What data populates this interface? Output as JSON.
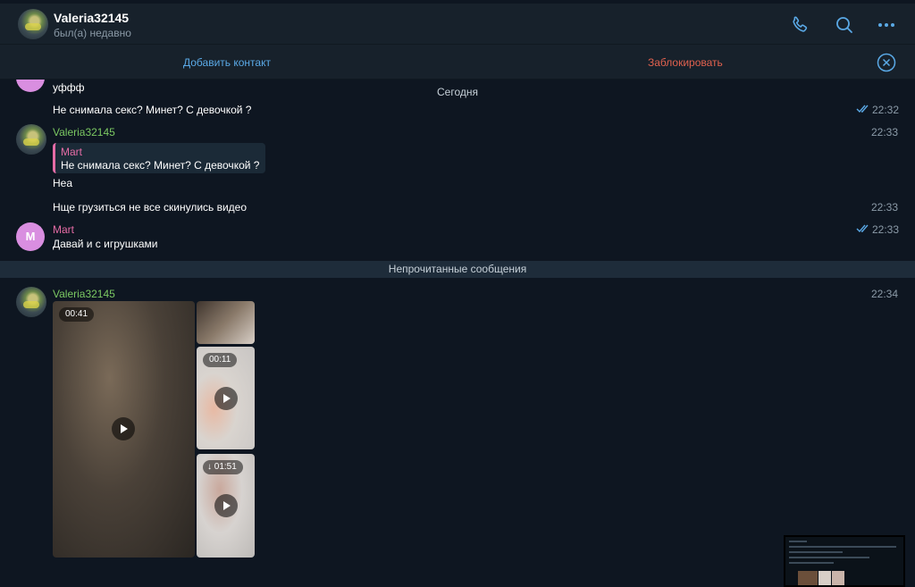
{
  "header": {
    "title": "Valeria32145",
    "status": "был(а) недавно"
  },
  "actions": {
    "add_contact": "Добавить контакт",
    "block": "Заблокировать"
  },
  "chat": {
    "partial_message": "уффф",
    "date_separator": "Сегодня",
    "unread_separator": "Непрочитанные сообщения",
    "messages": [
      {
        "text": "Не снимала секс? Минет? С девочкой ?",
        "time": "22:32"
      },
      {
        "sender": "Valeria32145",
        "time": "22:33",
        "reply_to_name": "Mart",
        "reply_to_text": "Не снимала секс? Минет? С девочкой ?",
        "text": "Неа"
      },
      {
        "text": "Нще грузиться не все скинулись видео",
        "time": "22:33"
      },
      {
        "sender": "Mart",
        "avatar_letter": "M",
        "text": "Давай и с игрушками",
        "time": "22:33"
      },
      {
        "sender": "Valeria32145",
        "time": "22:34"
      }
    ],
    "media": {
      "video1_duration": "00:41",
      "video3_duration": "00:11",
      "video4_duration": "01:51"
    }
  },
  "colors": {
    "accent_blue": "#5aa9e6",
    "danger_red": "#e0614e",
    "name_green": "#7bc862",
    "name_pink": "#e56ca6",
    "chat_bg": "#0e1621",
    "panel_bg": "#17212b"
  },
  "icons": [
    "phone-icon",
    "search-icon",
    "more-icon",
    "close-icon",
    "double-check-icon",
    "play-icon",
    "download-icon"
  ]
}
